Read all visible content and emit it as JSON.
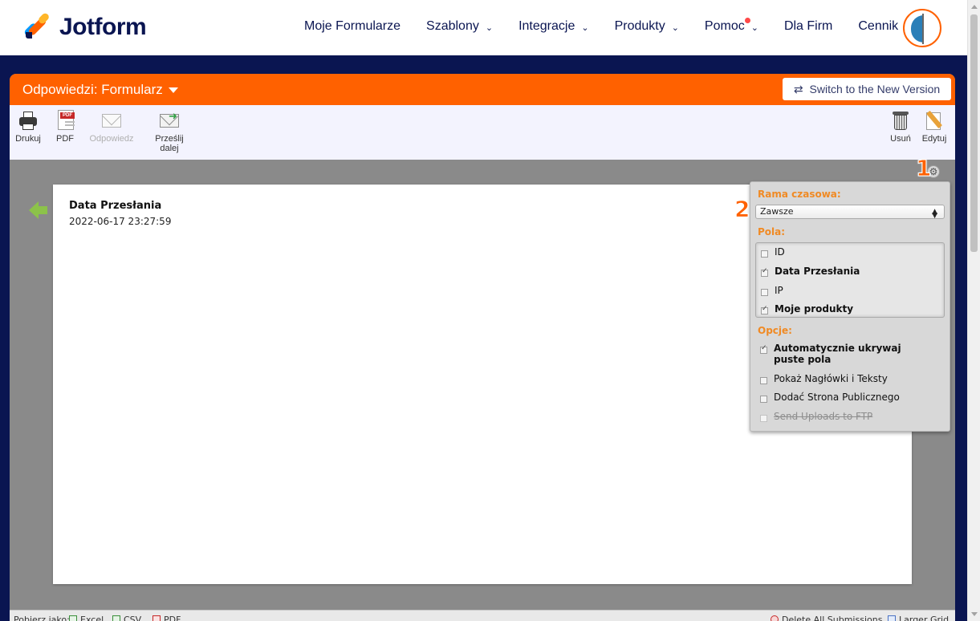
{
  "nav": {
    "logo_text": "Jotform",
    "links": [
      {
        "label": "Moje Formularze",
        "dropdown": false
      },
      {
        "label": "Szablony",
        "dropdown": true
      },
      {
        "label": "Integracje",
        "dropdown": true
      },
      {
        "label": "Produkty",
        "dropdown": true
      },
      {
        "label": "Pomoc",
        "dropdown": true,
        "notification": true
      },
      {
        "label": "Dla Firm",
        "dropdown": false
      },
      {
        "label": "Cennik",
        "dropdown": false
      }
    ]
  },
  "header": {
    "title": "Odpowiedzi: Formularz",
    "switch_label": "Switch to the New Version"
  },
  "toolbar": {
    "print": "Drukuj",
    "pdf": "PDF",
    "reply": "Odpowiedz",
    "forward": "Prześlij dalej",
    "delete": "Usuń",
    "edit": "Edytuj"
  },
  "submission": {
    "field_label": "Data Przesłania",
    "field_value": "2022-06-17 23:27:59"
  },
  "annotations": {
    "badge1": "1",
    "badge2": "2"
  },
  "settings": {
    "timeframe_label": "Rama czasowa:",
    "timeframe_value": "Zawsze",
    "fields_label": "Pola:",
    "fields": [
      {
        "label": "ID",
        "checked": false
      },
      {
        "label": "Data Przesłania",
        "checked": true
      },
      {
        "label": "IP",
        "checked": false
      },
      {
        "label": "Moje produkty",
        "checked": true
      }
    ],
    "options_label": "Opcje:",
    "options": [
      {
        "label": "Automatycznie ukrywaj puste pola",
        "checked": true
      },
      {
        "label": "Pokaż Nagłówki i Teksty",
        "checked": false
      },
      {
        "label": "Dodać Strona Publicznego",
        "checked": false
      },
      {
        "label": "Send Uploads to FTP",
        "checked": false,
        "disabled": true
      }
    ]
  },
  "bottom": {
    "export_label": "Pobierz jako:",
    "excel": "Excel",
    "csv": "CSV",
    "pdf": "PDF",
    "delete_all": "Delete All Submissions",
    "larger_grid": "Larger Grid"
  },
  "colors": {
    "brand_orange": "#ff6100",
    "navy": "#0a1551",
    "settings_heading": "#f08a24"
  }
}
